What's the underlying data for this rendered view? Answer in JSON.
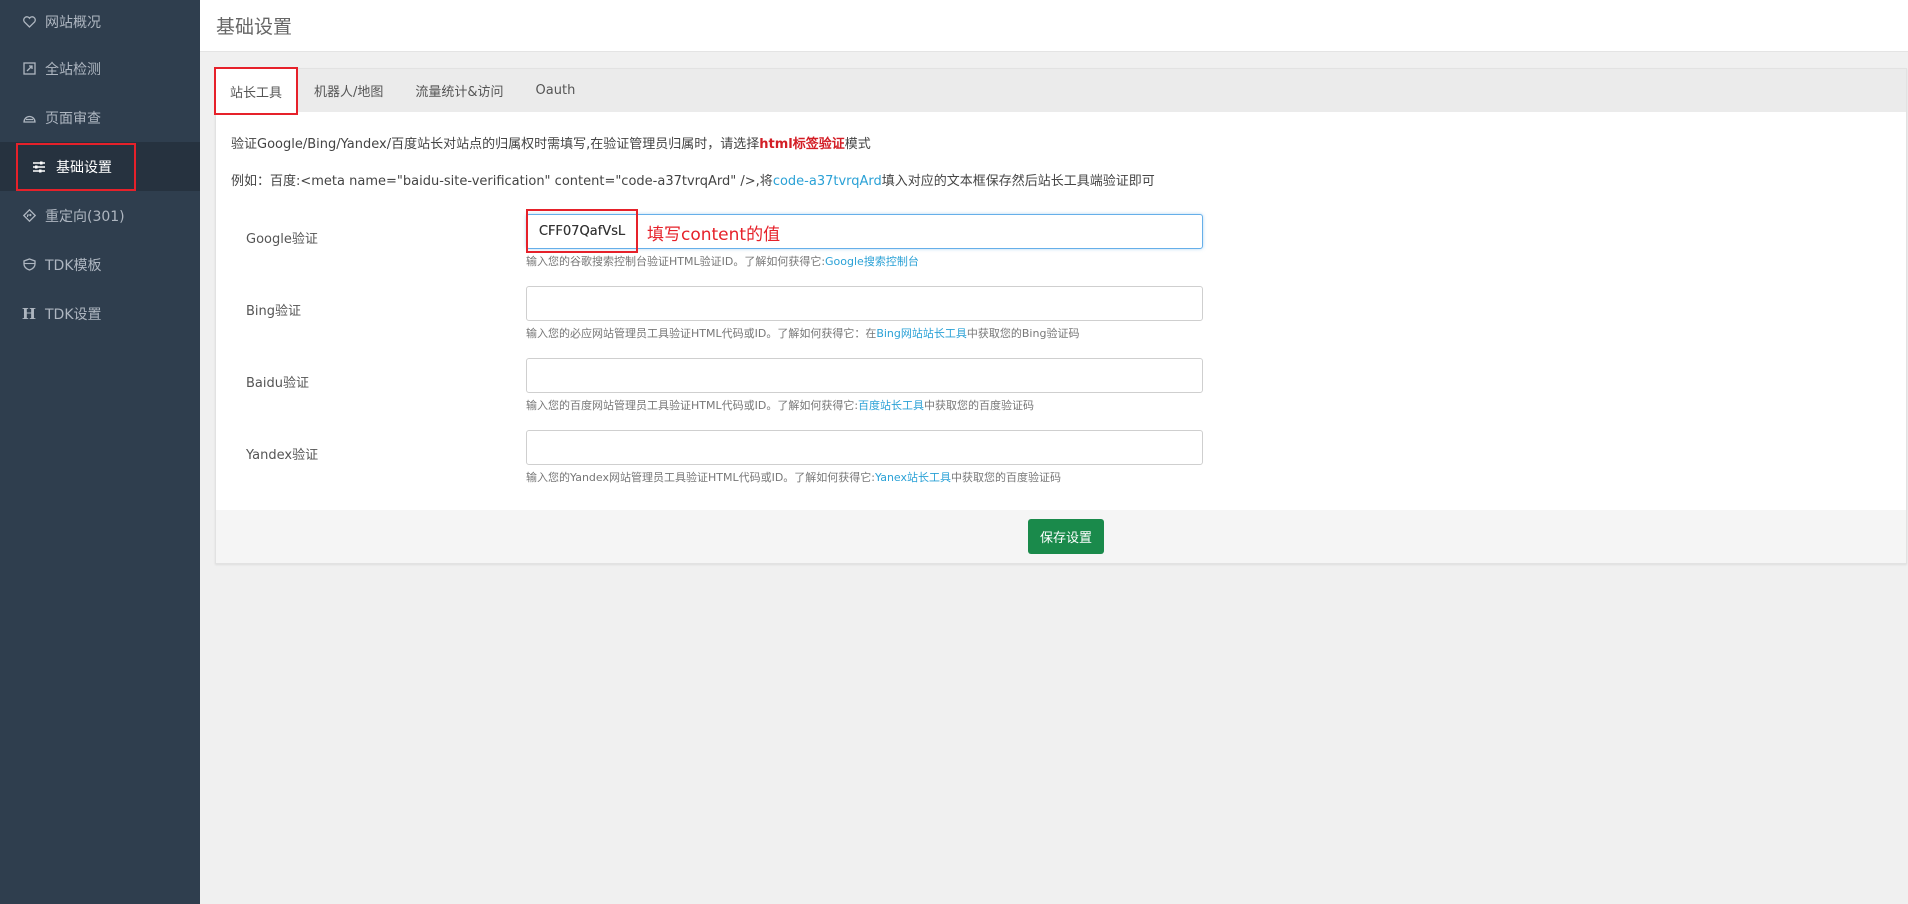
{
  "sidebar": {
    "items": [
      {
        "label": "网站概况",
        "icon": "heart-icon"
      },
      {
        "label": "全站检测",
        "icon": "external-link-icon"
      },
      {
        "label": "页面审查",
        "icon": "gauge-icon"
      },
      {
        "label": "基础设置",
        "icon": "sliders-icon",
        "active": true
      },
      {
        "label": "重定向(301)",
        "icon": "diamond-arrow-icon"
      },
      {
        "label": "TDK模板",
        "icon": "shield-icon"
      },
      {
        "label": "TDK设置",
        "icon": "heading-icon",
        "glyph": "H"
      }
    ]
  },
  "header": {
    "title": "基础设置"
  },
  "tabs": [
    {
      "label": "站长工具",
      "active": true
    },
    {
      "label": "机器人/地图"
    },
    {
      "label": "流量统计&访问"
    },
    {
      "label": "Oauth"
    }
  ],
  "intro": {
    "line1_prefix": "验证Google/Bing/Yandex/百度站长对站点的归属权时需填写,在验证管理员归属时，请选择",
    "line1_emphasis": "html标签验证",
    "line1_suffix": "模式",
    "line2_prefix": "例如：百度:<meta name=\"baidu-site-verification\" content=\"code-a37tvrqArd\" />,将",
    "line2_code": "code-a37tvrqArd",
    "line2_suffix": "填入对应的文本框保存然后站长工具端验证即可"
  },
  "fields": {
    "google": {
      "label": "Google验证",
      "value": "CFF07QafVsL",
      "annotation": "填写content的值",
      "help_prefix": "输入您的谷歌搜索控制台验证HTML验证ID。了解如何获得它:",
      "help_link": "Google搜索控制台",
      "help_suffix": ""
    },
    "bing": {
      "label": "Bing验证",
      "value": "",
      "help_prefix": "输入您的必应网站管理员工具验证HTML代码或ID。了解如何获得它：在",
      "help_link": "Bing网站站长工具",
      "help_suffix": "中获取您的Bing验证码"
    },
    "baidu": {
      "label": "Baidu验证",
      "value": "",
      "help_prefix": "输入您的百度网站管理员工具验证HTML代码或ID。了解如何获得它:",
      "help_link": "百度站长工具",
      "help_suffix": "中获取您的百度验证码"
    },
    "yandex": {
      "label": "Yandex验证",
      "value": "",
      "help_prefix": "输入您的Yandex网站管理员工具验证HTML代码或ID。了解如何获得它:",
      "help_link": "Yanex站长工具",
      "help_suffix": "中获取您的百度验证码"
    }
  },
  "footer": {
    "save_label": "保存设置"
  },
  "colors": {
    "sidebar_bg": "#2f3e4e",
    "highlight_red": "#e6212a",
    "link_blue": "#2aa1d6",
    "save_green": "#1a8a4b"
  }
}
